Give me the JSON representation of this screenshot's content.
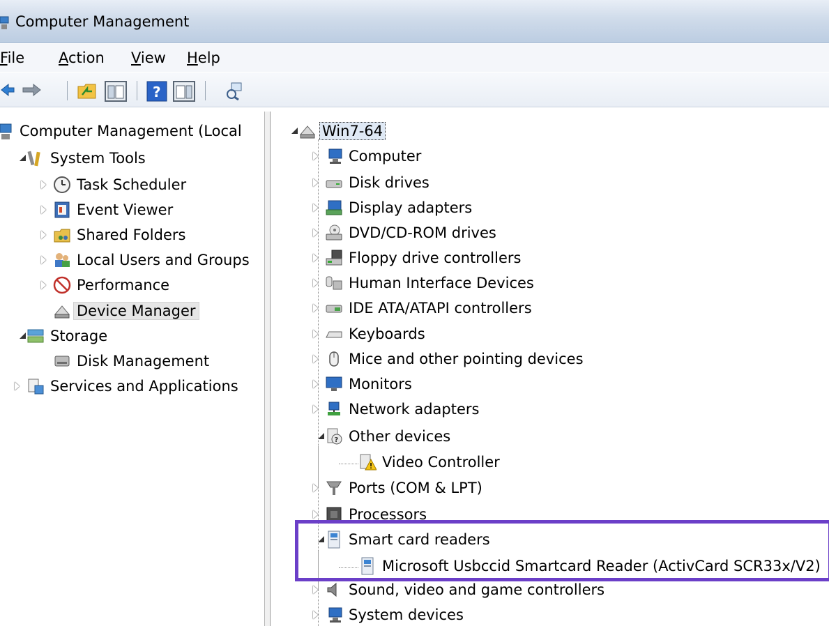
{
  "window": {
    "title": "Computer Management"
  },
  "menu": [
    {
      "accel": "F",
      "rest": "ile"
    },
    {
      "accel": "A",
      "rest": "ction"
    },
    {
      "accel": "V",
      "rest": "iew"
    },
    {
      "accel": "H",
      "rest": "elp"
    }
  ],
  "left_tree": {
    "root": "Computer Management (Local",
    "system_tools": "System Tools",
    "task_scheduler": "Task Scheduler",
    "event_viewer": "Event Viewer",
    "shared_folders": "Shared Folders",
    "local_users": "Local Users and Groups",
    "performance": "Performance",
    "device_manager": "Device Manager",
    "storage": "Storage",
    "disk_management": "Disk Management",
    "services_apps": "Services and Applications"
  },
  "device_tree": {
    "root": "Win7-64",
    "computer": "Computer",
    "disk_drives": "Disk drives",
    "display_adapters": "Display adapters",
    "dvd": "DVD/CD-ROM drives",
    "floppy": "Floppy drive controllers",
    "hid": "Human Interface Devices",
    "ide": "IDE ATA/ATAPI controllers",
    "keyboards": "Keyboards",
    "mice": "Mice and other pointing devices",
    "monitors": "Monitors",
    "network": "Network adapters",
    "other": "Other devices",
    "video_controller": "Video Controller",
    "ports": "Ports (COM & LPT)",
    "processors": "Processors",
    "smart_card": "Smart card readers",
    "smartcard_reader": "Microsoft Usbccid Smartcard Reader (ActivCard SCR33x/V2)",
    "sound": "Sound, video and game controllers",
    "system": "System devices"
  },
  "colors": {
    "highlight": "#6b3fc8",
    "titlebar": "#cfdbea"
  }
}
